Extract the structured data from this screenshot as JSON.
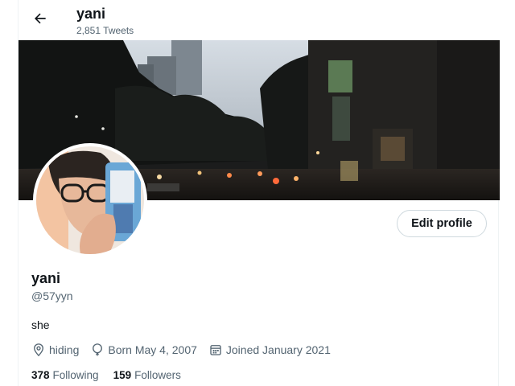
{
  "header": {
    "name": "yani",
    "tweet_count": "2,851 Tweets",
    "back_icon": "arrow-left-icon"
  },
  "profile": {
    "display_name": "yani",
    "handle": "@57yyn",
    "bio": "she",
    "location": "hiding",
    "birthday": "Born May 4, 2007",
    "joined": "Joined January 2021",
    "edit_label": "Edit profile"
  },
  "stats": {
    "following_count": "378",
    "following_label": "Following",
    "followers_count": "159",
    "followers_label": "Followers"
  },
  "icons": {
    "location": "location-pin-icon",
    "birthday": "balloon-icon",
    "joined": "calendar-icon"
  },
  "colors": {
    "text_primary": "#0f1419",
    "text_secondary": "#536471",
    "border": "#cfd9de"
  }
}
